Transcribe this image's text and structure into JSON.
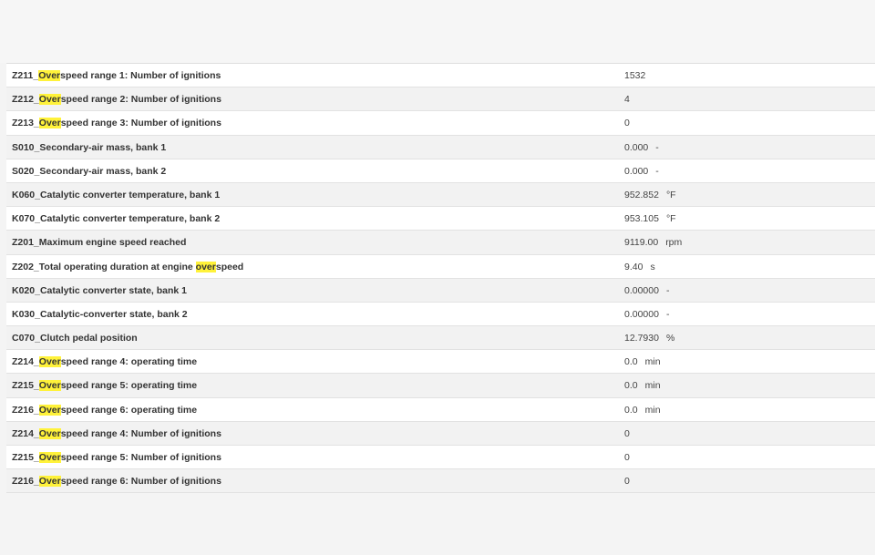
{
  "rows": [
    {
      "pre": "Z211_",
      "hl": "Over",
      "post": "speed range 1: Number of ignitions",
      "value": "1532",
      "unit": ""
    },
    {
      "pre": "Z212_",
      "hl": "Over",
      "post": "speed range 2: Number of ignitions",
      "value": "4",
      "unit": ""
    },
    {
      "pre": "Z213_",
      "hl": "Over",
      "post": "speed range 3: Number of ignitions",
      "value": "0",
      "unit": ""
    },
    {
      "pre": "S010_Secondary-air mass, bank 1",
      "hl": "",
      "post": "",
      "value": "0.000",
      "unit": "-"
    },
    {
      "pre": "S020_Secondary-air mass, bank 2",
      "hl": "",
      "post": "",
      "value": "0.000",
      "unit": "-"
    },
    {
      "pre": "K060_Catalytic converter temperature, bank 1",
      "hl": "",
      "post": "",
      "value": "952.852",
      "unit": "°F"
    },
    {
      "pre": "K070_Catalytic converter temperature, bank 2",
      "hl": "",
      "post": "",
      "value": "953.105",
      "unit": "°F"
    },
    {
      "pre": "Z201_Maximum engine speed reached",
      "hl": "",
      "post": "",
      "value": "9119.00",
      "unit": "rpm"
    },
    {
      "pre": "Z202_Total operating duration at engine ",
      "hl": "over",
      "post": "speed",
      "value": "9.40",
      "unit": "s"
    },
    {
      "pre": "K020_Catalytic converter state, bank 1",
      "hl": "",
      "post": "",
      "value": "0.00000",
      "unit": "-"
    },
    {
      "pre": "K030_Catalytic-converter state, bank 2",
      "hl": "",
      "post": "",
      "value": "0.00000",
      "unit": "-"
    },
    {
      "pre": "C070_Clutch pedal position",
      "hl": "",
      "post": "",
      "value": "12.7930",
      "unit": "%"
    },
    {
      "pre": "Z214_",
      "hl": "Over",
      "post": "speed range 4: operating time",
      "value": "0.0",
      "unit": "min"
    },
    {
      "pre": "Z215_",
      "hl": "Over",
      "post": "speed range 5: operating time",
      "value": "0.0",
      "unit": "min"
    },
    {
      "pre": "Z216_",
      "hl": "Over",
      "post": "speed range 6: operating time",
      "value": "0.0",
      "unit": "min"
    },
    {
      "pre": "Z214_",
      "hl": "Over",
      "post": "speed range 4: Number of ignitions",
      "value": "0",
      "unit": ""
    },
    {
      "pre": "Z215_",
      "hl": "Over",
      "post": "speed range 5: Number of ignitions",
      "value": "0",
      "unit": ""
    },
    {
      "pre": "Z216_",
      "hl": "Over",
      "post": "speed range 6: Number of ignitions",
      "value": "0",
      "unit": ""
    }
  ],
  "colors": {
    "highlight": "#fff23a",
    "row_alt": "#f2f2f2",
    "row": "#ffffff",
    "border": "#e2e2e2",
    "text": "#333333"
  }
}
